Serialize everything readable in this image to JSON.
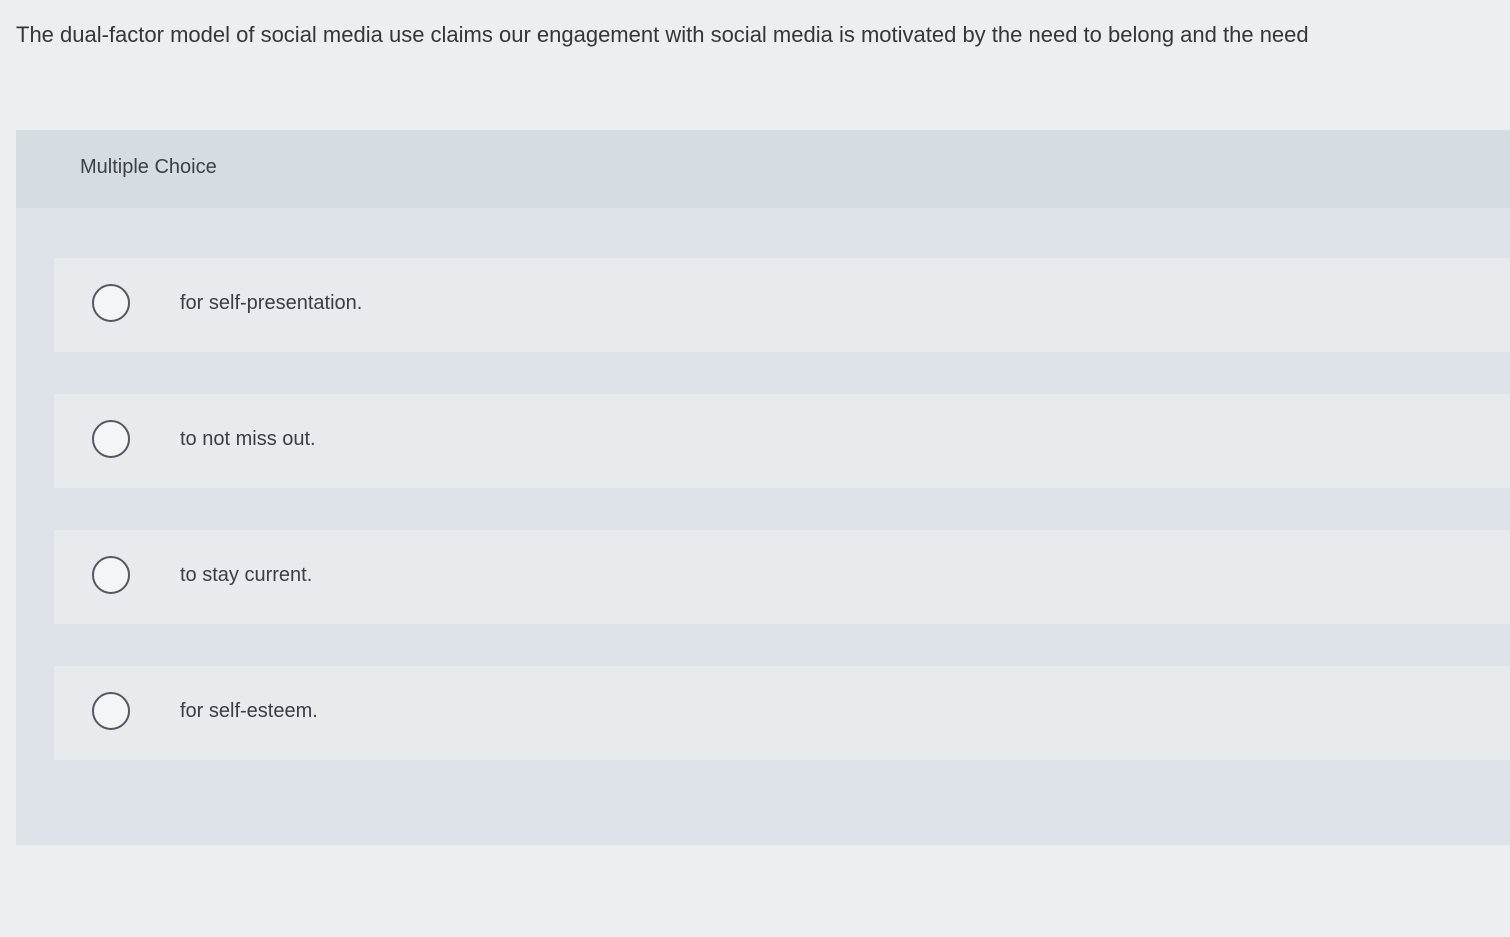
{
  "question": {
    "text": "The dual-factor model of social media use claims our engagement with social media is motivated by the need to belong and the need"
  },
  "panel": {
    "type_label": "Multiple Choice"
  },
  "choices": [
    {
      "label": "for self-presentation."
    },
    {
      "label": "to not miss out."
    },
    {
      "label": "to stay current."
    },
    {
      "label": "for self-esteem."
    }
  ],
  "colors": {
    "page_background": "#eceeef",
    "panel_background": "#dde3e8",
    "choice_background": "#e7ebee",
    "radio_border": "#54595f"
  }
}
